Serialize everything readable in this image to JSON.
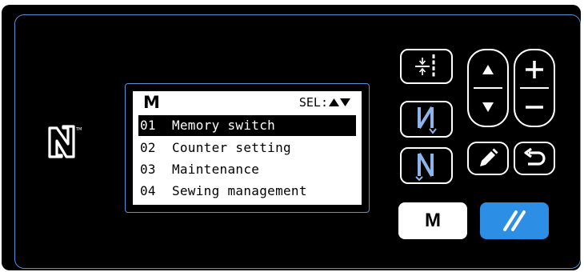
{
  "lcd": {
    "title": "M",
    "sel_label": "SEL:",
    "menu": [
      {
        "num": "01",
        "label": "Memory switch",
        "selected": true
      },
      {
        "num": "02",
        "label": "Counter setting",
        "selected": false
      },
      {
        "num": "03",
        "label": "Maintenance",
        "selected": false
      },
      {
        "num": "04",
        "label": "Sewing management",
        "selected": false
      }
    ]
  },
  "buttons": {
    "m_label": "M",
    "needle_label": "N",
    "reverse_needle_label": "N"
  },
  "icons": {
    "nfc": "nfc-n-mark-icon",
    "needle_position": "needle-position-icon",
    "up": "triangle-up-icon",
    "down": "triangle-down-icon",
    "plus": "plus-icon",
    "minus": "minus-icon",
    "edit": "pencil-icon",
    "back": "return-arrow-icon",
    "reset": "reset-slash-icon"
  },
  "colors": {
    "panel": "#000000",
    "accent_blue": "#2d8ee6",
    "frame_blue": "#5b8fd6",
    "n_button_blue": "#8fb4ea"
  }
}
